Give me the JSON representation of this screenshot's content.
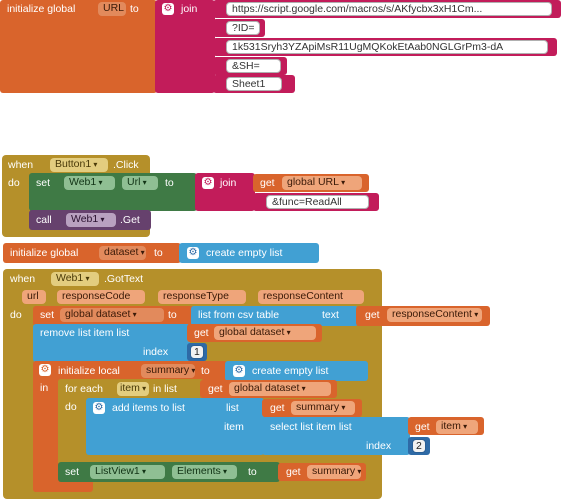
{
  "block1": {
    "initialize_global": "initialize global",
    "var_name": "URL",
    "to": "to",
    "join": "join",
    "strings": [
      "https://script.google.com/macros/s/AKfycbx3xH1Cm...",
      "?ID=",
      "1k531Sryh3YZApiMsR11UgMQKokEtAab0NGLGrPm3-dA",
      "&SH=",
      "Sheet1"
    ]
  },
  "block2": {
    "when": "when",
    "component": "Button1",
    "event": ".Click",
    "do": "do",
    "set": "set",
    "web": "Web1",
    "url_prop": "Url",
    "to": "to",
    "join": "join",
    "get": "get",
    "get_var": "global URL",
    "func_string": "&func=ReadAll",
    "call": "call",
    "call_web": "Web1",
    "call_method": ".Get"
  },
  "block3": {
    "initialize_global": "initialize global",
    "var_name": "dataset",
    "to": "to",
    "create_empty_list": "create empty list"
  },
  "block4": {
    "when": "when",
    "component": "Web1",
    "event": ".GotText",
    "params": [
      "url",
      "responseCode",
      "responseType",
      "responseContent"
    ],
    "do": "do",
    "set": "set",
    "set_var": "global dataset",
    "to": "to",
    "list_from_csv": "list from csv table",
    "text": "text",
    "get": "get",
    "response_content": "responseContent",
    "remove_list_item": "remove list item  list",
    "get_dataset": "global dataset",
    "index": "index",
    "index_value": "1",
    "initialize_local": "initialize local",
    "local_name": "summary",
    "local_to": "to",
    "create_empty_list": "create empty list",
    "in": "in",
    "for_each": "for each",
    "item_name": "item",
    "in_list": "in list",
    "do_inner": "do",
    "add_items": "add items to list",
    "list": "list",
    "get_summary": "summary",
    "item": "item",
    "select_list_item": "select list item  list",
    "get_item": "item",
    "index2": "index",
    "index2_value": "2",
    "set2": "set",
    "listview": "ListView1",
    "elements": "Elements",
    "to2": "to",
    "get_summary2": "summary"
  }
}
